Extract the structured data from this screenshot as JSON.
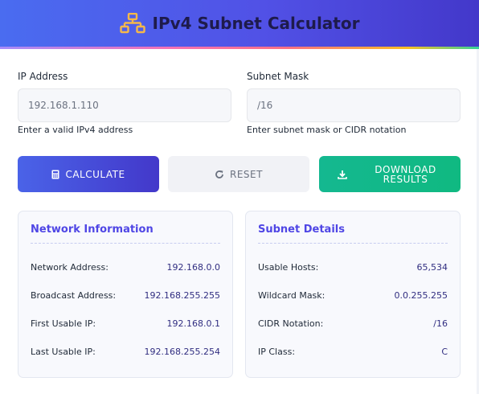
{
  "header": {
    "title": "IPv4 Subnet Calculator",
    "icon": "network-sitemap-icon",
    "gradient_start": "#4a6cf0",
    "gradient_end": "#4338ca",
    "icon_color": "#f5b84a"
  },
  "form": {
    "ip": {
      "label": "IP Address",
      "value": "192.168.1.110",
      "hint": "Enter a valid IPv4 address"
    },
    "mask": {
      "label": "Subnet Mask",
      "value": "/16",
      "hint": "Enter subnet mask or CIDR notation"
    }
  },
  "buttons": {
    "calculate": {
      "label": "CALCULATE",
      "icon": "calculator-icon",
      "color": "#4a63e8"
    },
    "reset": {
      "label": "RESET",
      "icon": "refresh-icon"
    },
    "download": {
      "label": "DOWNLOAD RESULTS",
      "icon": "download-icon",
      "color": "#10b981"
    }
  },
  "network_info": {
    "title": "Network Information",
    "rows": [
      {
        "label": "Network Address:",
        "value": "192.168.0.0"
      },
      {
        "label": "Broadcast Address:",
        "value": "192.168.255.255"
      },
      {
        "label": "First Usable IP:",
        "value": "192.168.0.1"
      },
      {
        "label": "Last Usable IP:",
        "value": "192.168.255.254"
      }
    ]
  },
  "subnet_details": {
    "title": "Subnet Details",
    "rows": [
      {
        "label": "Usable Hosts:",
        "value": "65,534"
      },
      {
        "label": "Wildcard Mask:",
        "value": "0.0.255.255"
      },
      {
        "label": "CIDR Notation:",
        "value": "/16"
      },
      {
        "label": "IP Class:",
        "value": "C"
      }
    ]
  }
}
